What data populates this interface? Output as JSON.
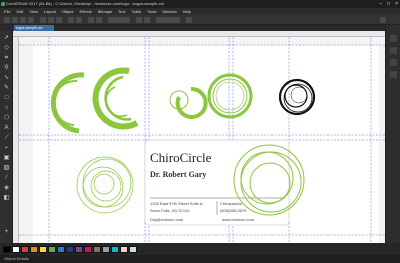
{
  "titlebar": {
    "title": "CorelDRAW 2017 (64-Bit) - C:\\Users\\..\\Desktop\\...\\business card\\logo...\\logos-sample.cdr",
    "min": "–",
    "max": "□",
    "close": "×"
  },
  "menu": [
    "File",
    "Edit",
    "View",
    "Layout",
    "Object",
    "Effects",
    "Bitmaps",
    "Text",
    "Table",
    "Tools",
    "Window",
    "Help"
  ],
  "tab": {
    "label": "logos-sample.cdr"
  },
  "toolbox": {
    "tools": [
      "pick-tool",
      "shape-tool",
      "crop-tool",
      "zoom-tool",
      "freehand-tool",
      "artistic-media-tool",
      "rectangle-tool",
      "ellipse-tool",
      "polygon-tool",
      "text-tool",
      "parallel-dimension-tool",
      "connector-tool",
      "drop-shadow-tool",
      "transparency-tool",
      "eyedropper-tool",
      "interactive-fill-tool",
      "smart-fill-tool"
    ]
  },
  "card": {
    "company": "ChiroCircle",
    "person": "Dr. Robert Gary",
    "address1": "1320 East 57th Street Suite A",
    "address2": "Sioux Falls, SD 57124",
    "role": "Chiropractor",
    "phone": "(605)555-0679",
    "email": "Drg@chirocrc.com",
    "web": "www.chirocrc.com"
  },
  "colors": {
    "accent_green": "#8cc63f",
    "selected_black": "#111111",
    "guide_blue": "#5b6fd6"
  },
  "palette": [
    "#000000",
    "#ffffff",
    "#e23c2a",
    "#f28a1e",
    "#f7e01c",
    "#5bb247",
    "#2c7bd1",
    "#1f3a93",
    "#7d3f98",
    "#c2185b",
    "#8d6e63",
    "#9e9e9e",
    "#00bcd4",
    "#ffcdd2",
    "#c8e6c9"
  ],
  "status": {
    "text": "Object Details"
  }
}
